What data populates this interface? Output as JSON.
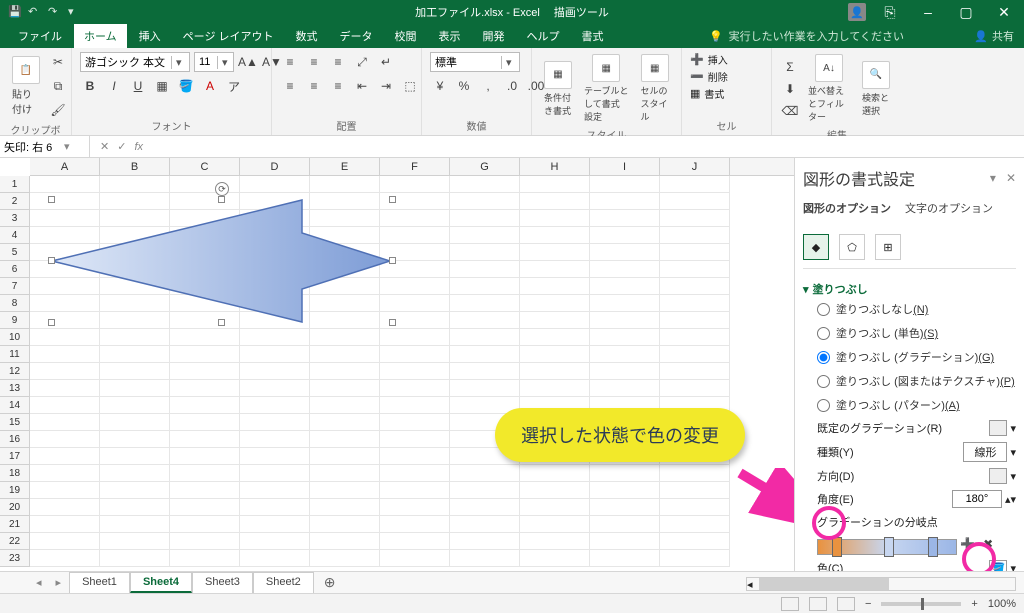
{
  "titlebar": {
    "filename": "加工ファイル.xlsx - Excel",
    "drawing_tools": "描画ツール"
  },
  "window": {
    "min": "–",
    "max": "▢",
    "close": "✕",
    "restore": "⎘"
  },
  "tabs": {
    "file": "ファイル",
    "home": "ホーム",
    "insert": "挿入",
    "layout": "ページ レイアウト",
    "formulas": "数式",
    "data": "データ",
    "review": "校閲",
    "view": "表示",
    "developer": "開発",
    "help": "ヘルプ",
    "format": "書式",
    "tellme": "実行したい作業を入力してください",
    "share": "共有"
  },
  "ribbon": {
    "clipboard": {
      "label": "クリップボード",
      "paste": "貼り付け"
    },
    "font": {
      "label": "フォント",
      "name": "游ゴシック 本文",
      "size": "11",
      "bold": "B",
      "italic": "I",
      "underline": "U"
    },
    "alignment": {
      "label": "配置"
    },
    "number": {
      "label": "数値",
      "format": "標準"
    },
    "styles": {
      "label": "スタイル",
      "cond": "条件付き書式",
      "table": "テーブルとして書式設定",
      "cell": "セルのスタイル"
    },
    "cells": {
      "label": "セル",
      "insert": "挿入",
      "delete": "削除",
      "format": "書式"
    },
    "editing": {
      "label": "編集",
      "sort": "並べ替えとフィルター",
      "find": "検索と選択"
    }
  },
  "namebox": "矢印: 右 6",
  "fx": "fx",
  "columns": [
    "A",
    "B",
    "C",
    "D",
    "E",
    "F",
    "G",
    "H",
    "I",
    "J"
  ],
  "rows": [
    "1",
    "2",
    "3",
    "4",
    "5",
    "6",
    "7",
    "8",
    "9",
    "10",
    "11",
    "12",
    "13",
    "14",
    "15",
    "16",
    "17",
    "18",
    "19",
    "20",
    "21",
    "22",
    "23"
  ],
  "callout": "選択した状態で色の変更",
  "sheets": [
    "Sheet1",
    "Sheet4",
    "Sheet3",
    "Sheet2"
  ],
  "active_sheet": 1,
  "pane": {
    "title": "図形の書式設定",
    "tabs": {
      "shape": "図形のオプション",
      "text": "文字のオプション"
    },
    "fill": {
      "header": "塗りつぶし",
      "none": "塗りつぶしなし",
      "none_k": "(N)",
      "solid": "塗りつぶし (単色)",
      "solid_k": "(S)",
      "grad": "塗りつぶし (グラデーション)",
      "grad_k": "(G)",
      "pict": "塗りつぶし (図またはテクスチャ)",
      "pict_k": "(P)",
      "patt": "塗りつぶし (パターン)",
      "patt_k": "(A)"
    },
    "preset": "既定のグラデーション",
    "preset_k": "(R)",
    "type": "種類",
    "type_k": "(Y)",
    "type_val": "線形",
    "dir": "方向",
    "dir_k": "(D)",
    "angle": "角度",
    "angle_k": "(E)",
    "angle_val": "180°",
    "stops": "グラデーションの分岐点",
    "color": "色",
    "color_k": "(C)"
  },
  "status": {
    "zoom": "100%"
  }
}
